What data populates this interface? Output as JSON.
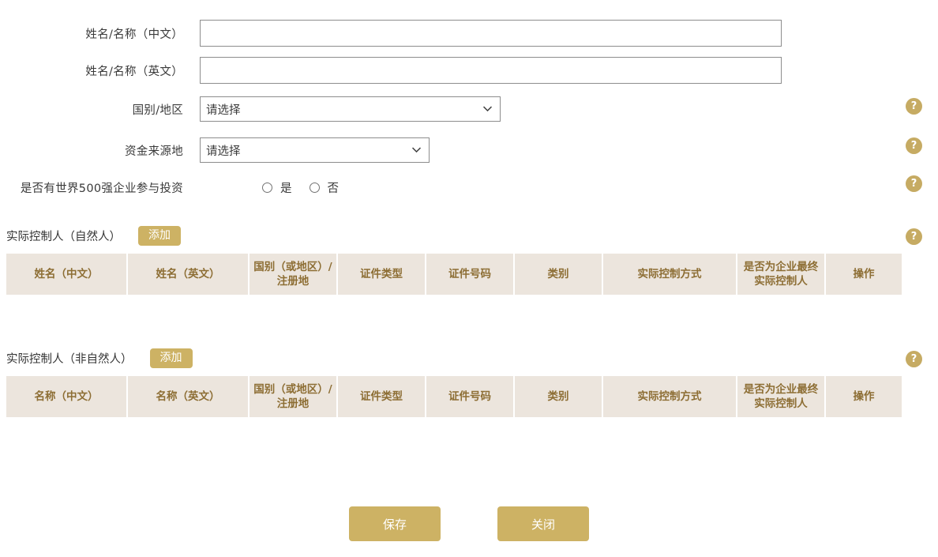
{
  "form": {
    "fields": [
      {
        "label": "姓名/名称（中文）",
        "type": "text",
        "value": "",
        "placeholder": ""
      },
      {
        "label": "姓名/名称（英文）",
        "type": "text",
        "value": "",
        "placeholder": ""
      },
      {
        "label": "国别/地区",
        "type": "select",
        "value": "请选择"
      },
      {
        "label": "资金来源地",
        "type": "select",
        "value": "请选择"
      },
      {
        "label": "是否有世界500强企业参与投资",
        "type": "radio"
      }
    ],
    "radio_options": [
      {
        "label": "是",
        "checked": false
      },
      {
        "label": "否",
        "checked": false
      }
    ]
  },
  "help": {
    "glyph": "?",
    "name": "help-icon",
    "color": "#c6ab63"
  },
  "icons": {
    "caret": "chevron-down-icon"
  },
  "sections": [
    {
      "title": "实际控制人（自然人）",
      "add_label": "添加",
      "columns": [
        "姓名（中文）",
        "姓名（英文）",
        "国别（或地区）/注册地",
        "证件类型",
        "证件号码",
        "类别",
        "实际控制方式",
        "是否为企业最终实际控制人",
        "操作"
      ],
      "rows": []
    },
    {
      "title": "实际控制人（非自然人）",
      "add_label": "添加",
      "columns": [
        "名称（中文）",
        "名称（英文）",
        "国别（或地区）/注册地",
        "证件类型",
        "证件号码",
        "类别",
        "实际控制方式",
        "是否为企业最终实际控制人",
        "操作"
      ],
      "rows": []
    }
  ],
  "footer": {
    "save_label": "保存",
    "close_label": "关闭"
  },
  "colors": {
    "accent": "#cdb264",
    "table_header_bg": "#ece5dd",
    "table_header_text": "#8d6e34",
    "help_bg": "#c6ab63"
  }
}
